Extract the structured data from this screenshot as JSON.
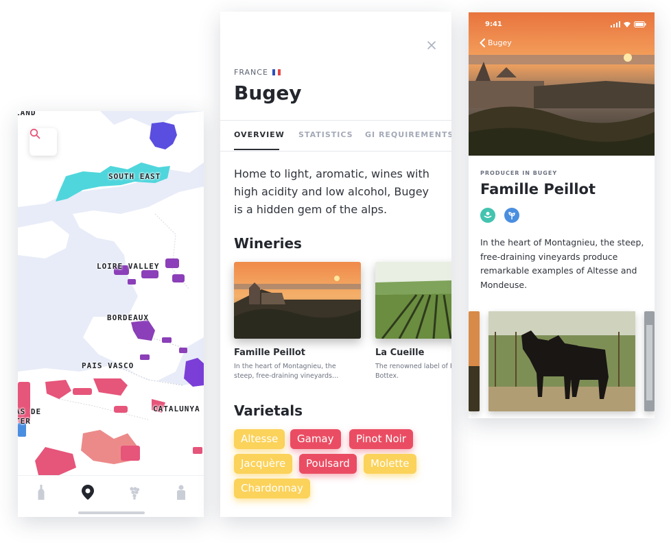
{
  "map_screen": {
    "corner_label": "LAND",
    "regions": [
      {
        "label": "SOUTH EAST"
      },
      {
        "label": "LOIRE VALLEY"
      },
      {
        "label": "BORDEAUX"
      },
      {
        "label": "PAIS VASCO"
      },
      {
        "label": "CATALUNYA"
      },
      {
        "label": "AS DE"
      },
      {
        "label": "TER"
      }
    ],
    "search_icon": "search-icon",
    "tab_icons": [
      "wine-bottle-icon",
      "map-pin-icon",
      "grapes-icon",
      "person-icon"
    ],
    "active_tab_index": 1
  },
  "detail_screen": {
    "close_icon": "close-icon",
    "country": "FRANCE",
    "title": "Bugey",
    "tabs": [
      {
        "label": "OVERVIEW",
        "active": true
      },
      {
        "label": "STATISTICS",
        "active": false
      },
      {
        "label": "GI REQUIREMENTS",
        "active": false
      }
    ],
    "intro": "Home to light, aromatic, wines with high acidity and low alcohol, Bugey is a hidden gem of the alps.",
    "wineries_heading": "Wineries",
    "wineries": [
      {
        "name": "Famille Peillot",
        "desc": "In the heart of Montagnieu, the steep, free-draining vineyards…"
      },
      {
        "name": "La Cueille",
        "desc": "The renowned label of Patrick Bottex."
      }
    ],
    "varietals_heading": "Varietals",
    "varietals": [
      {
        "label": "Altesse",
        "color": "#fbd25a"
      },
      {
        "label": "Gamay",
        "color": "#ea4d63"
      },
      {
        "label": "Pinot Noir",
        "color": "#ea4d63"
      },
      {
        "label": "Jacquère",
        "color": "#fbd25a"
      },
      {
        "label": "Poulsard",
        "color": "#ea4d63"
      },
      {
        "label": "Molette",
        "color": "#fbd25a"
      },
      {
        "label": "Chardonnay",
        "color": "#fbd25a"
      }
    ]
  },
  "producer_screen": {
    "time": "9:41",
    "back_label": "Bugey",
    "kicker": "PRODUCER IN BUGEY",
    "title": "Famille Peillot",
    "badges": [
      "organic-icon",
      "sustainable-icon"
    ],
    "description": "In the heart of Montagnieu, the steep, free-draining vineyards produce remarkable examples of Altesse and Mondeuse."
  },
  "colors": {
    "yellow_pill": "#fbd25a",
    "red_pill": "#ea4d63",
    "south_east": "#4fd6dc",
    "loire": "#8b3fb8",
    "kent": "#5a4ee0",
    "spain": "#e6557a"
  }
}
